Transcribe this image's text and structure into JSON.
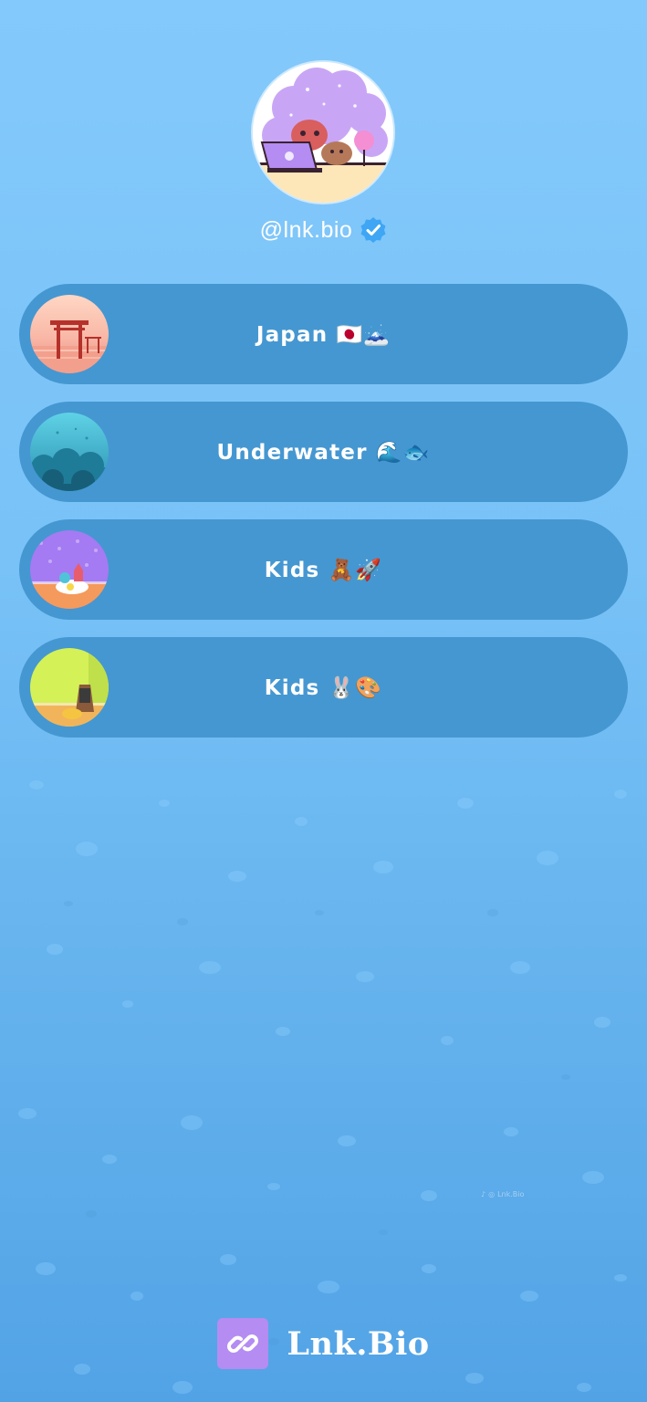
{
  "profile": {
    "handle": "@lnk.bio",
    "verified": true,
    "avatar_icon": "avatar-illustration"
  },
  "links": [
    {
      "label": "Japan 🇯🇵🗻",
      "thumb_icon": "torii-gate-thumb"
    },
    {
      "label": "Underwater 🌊🐟",
      "thumb_icon": "underwater-thumb"
    },
    {
      "label": "Kids 🧸🚀",
      "thumb_icon": "toys-room-thumb"
    },
    {
      "label": "Kids 🐰🎨",
      "thumb_icon": "easel-room-thumb"
    }
  ],
  "watermark": {
    "text": "Lnk.Bio",
    "icons": [
      "tiktok-icon",
      "instagram-icon"
    ]
  },
  "footer": {
    "brand_name": "Lnk.Bio",
    "brand_icon": "link-chain-icon"
  },
  "colors": {
    "background_top": "#84c9fb",
    "background_bottom": "#52a3e6",
    "button_bg": "#4597d1",
    "text": "#ffffff",
    "verified_badge": "#3ea6f4",
    "brand_logo_bg": "#b48cf2"
  }
}
